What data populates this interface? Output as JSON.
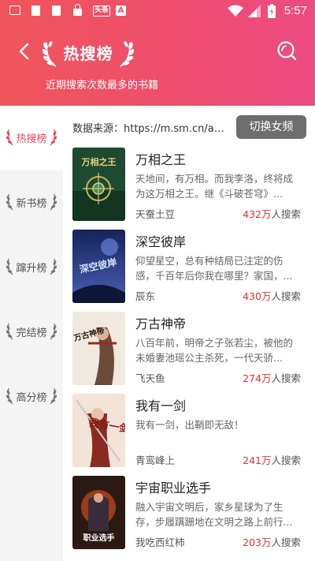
{
  "status_bar": {
    "time": "5:57",
    "badge_text": "头条",
    "a_text": "A"
  },
  "header": {
    "title": "热搜榜",
    "subtitle": "近期搜索次数最多的书籍"
  },
  "sidebar": {
    "items": [
      {
        "label": "热搜榜",
        "active": true
      },
      {
        "label": "新书榜",
        "active": false
      },
      {
        "label": "蹿升榜",
        "active": false
      },
      {
        "label": "完结榜",
        "active": false
      },
      {
        "label": "高分榜",
        "active": false
      }
    ]
  },
  "main": {
    "source_text": "数据来源：https://m.sm.cn/ap...",
    "switch_label": "切换女频",
    "count_suffix": "人搜索",
    "books": [
      {
        "title": "万相之王",
        "desc": "天地间，有万相。而我李洛，终将成为这万相之王。继《斗破苍穹》...",
        "author": "天蚕土豆",
        "count": "432万"
      },
      {
        "title": "深空彼岸",
        "desc": "仰望星空，总有种结局已注定的伤感，千百年后你我在哪里？家国，...",
        "author": "辰东",
        "count": "430万"
      },
      {
        "title": "万古神帝",
        "desc": "八百年前，明帝之子张若尘，被他的未婚妻池瑶公主杀死，一代天骄...",
        "author": "飞天鱼",
        "count": "274万"
      },
      {
        "title": "我有一剑",
        "desc": "我有一剑，出鞘即无敌！",
        "author": "青鸾峰上",
        "count": "241万"
      },
      {
        "title": "宇宙职业选手",
        "desc": "融入宇宙文明后，家乡星球为了生存，步履蹒跚地在文明之路上前行...",
        "author": "我吃西红柿",
        "count": "203万"
      }
    ]
  },
  "cover_art": {
    "c1": "万相之王",
    "c2": "深空彼岸",
    "c3": "万古神帝",
    "c4": "我有一剑",
    "c5": "职业选手"
  }
}
